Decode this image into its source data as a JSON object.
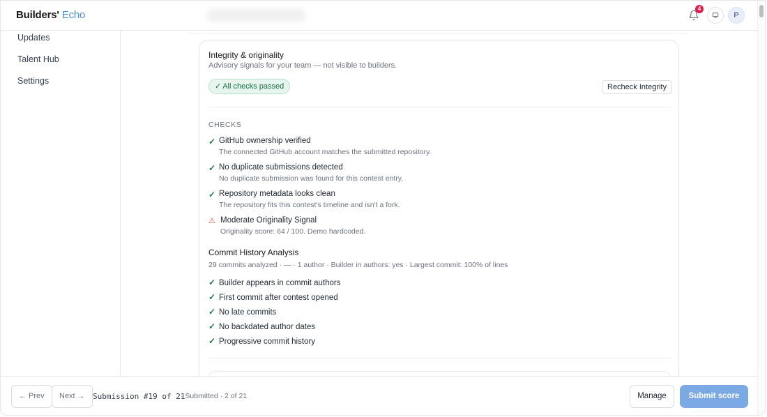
{
  "header": {
    "brand_main": "Builders'",
    "brand_accent": "Echo",
    "notification_count": "4",
    "avatar_initial": "P",
    "icons": {
      "notifications": "bell-icon",
      "display": "monitor-icon"
    }
  },
  "sidebar": {
    "items": [
      {
        "label": "Updates"
      },
      {
        "label": "Talent Hub"
      },
      {
        "label": "Settings"
      }
    ]
  },
  "integrity": {
    "title": "Integrity & originality",
    "subtitle": "Advisory signals for your team — not visible to builders.",
    "status_label": "All checks passed",
    "recheck_label": "Recheck Integrity",
    "section_label": "CHECKS",
    "checks": [
      {
        "status": "pass",
        "title": "GitHub ownership verified",
        "desc": "The connected GitHub account matches the submitted repository."
      },
      {
        "status": "pass",
        "title": "No duplicate submissions detected",
        "desc": "No duplicate submission was found for this contest entry."
      },
      {
        "status": "pass",
        "title": "Repository metadata looks clean",
        "desc": "The repository fits this contest's timeline and isn't a fork."
      },
      {
        "status": "warning",
        "title": "Moderate Originality Signal",
        "desc": "Originality score: 64 / 100. Demo hardcoded."
      }
    ],
    "commit_history": {
      "title": "Commit History Analysis",
      "summary": "29 commits analyzed · — · 1 author · Builder in authors: yes · Largest commit: 100% of lines",
      "items": [
        "Builder appears in commit authors",
        "First commit after contest opened",
        "No late commits",
        "No backdated author dates",
        "Progressive commit history"
      ]
    }
  },
  "footer": {
    "prev_label": "← Prev",
    "next_label": "Next →",
    "submission_counter": "Submission #19 of 21",
    "submission_status": "· Submitted · 2 of 21",
    "manage_label": "Manage",
    "submit_label": "Submit score"
  },
  "colors": {
    "accent": "#4b8fd8",
    "submit": "#7ba9e3",
    "success": "#1d7a4b",
    "warning": "#d9534f",
    "badge": "#e11d48"
  }
}
